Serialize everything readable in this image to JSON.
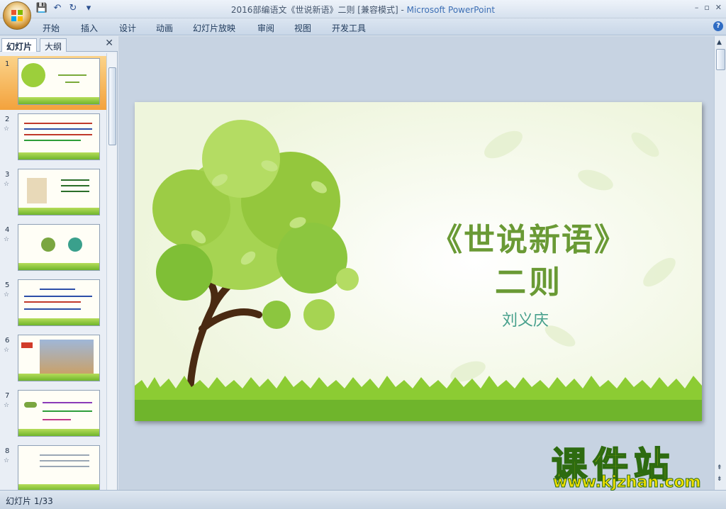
{
  "window": {
    "title": "2016部编语文《世说新语》二则 [兼容模式] - ",
    "app_name": "Microsoft PowerPoint",
    "controls": [
      "–",
      "▫",
      "✕"
    ]
  },
  "qat": {
    "save": "💾",
    "undo": "↶",
    "redo": "↻",
    "more": "▾"
  },
  "ribbon": {
    "tabs": [
      "开始",
      "插入",
      "设计",
      "动画",
      "幻灯片放映",
      "审阅",
      "视图",
      "开发工具"
    ],
    "help": "?"
  },
  "left_pane": {
    "tabs": [
      "幻灯片",
      "大纲"
    ],
    "close": "✕",
    "thumbnails": [
      {
        "num": "1",
        "selected": true
      },
      {
        "num": "2"
      },
      {
        "num": "3"
      },
      {
        "num": "4"
      },
      {
        "num": "5"
      },
      {
        "num": "6"
      },
      {
        "num": "7"
      },
      {
        "num": "8"
      }
    ]
  },
  "slide": {
    "title": "《世说新语》",
    "subtitle": "二则",
    "author": "刘义庆"
  },
  "status": {
    "slide_indicator": "幻灯片 1/33"
  },
  "watermark": {
    "logo": "课件站",
    "url": "www.kjzhan.com"
  },
  "colors": {
    "title_green": "#6a9a35",
    "author_teal": "#47a08c",
    "grass": "#7cc22e",
    "leaf": "#8cc63f"
  }
}
